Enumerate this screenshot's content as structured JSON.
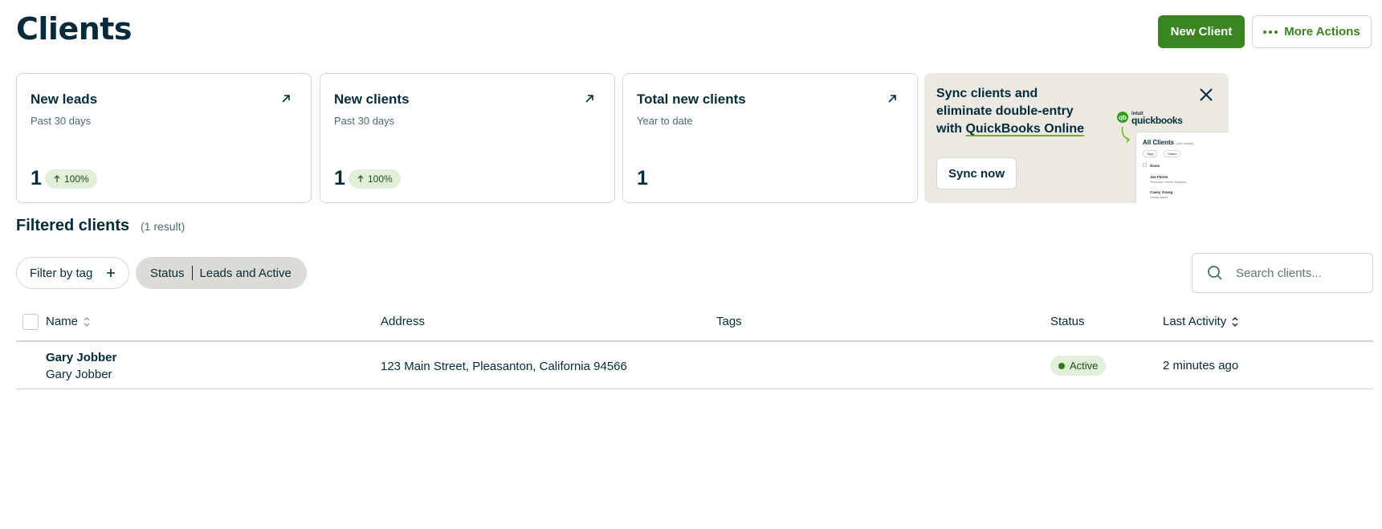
{
  "header": {
    "title": "Clients",
    "new_client_label": "New Client",
    "more_actions_label": "More Actions"
  },
  "cards": [
    {
      "title": "New leads",
      "subtitle": "Past 30 days",
      "value": "1",
      "trend": "100%"
    },
    {
      "title": "New clients",
      "subtitle": "Past 30 days",
      "value": "1",
      "trend": "100%"
    },
    {
      "title": "Total new clients",
      "subtitle": "Year to date",
      "value": "1",
      "trend": ""
    }
  ],
  "promo": {
    "text_before": "Sync clients and eliminate double-entry with ",
    "link": "QuickBooks Online",
    "button": "Sync now",
    "logo_small": "intuit",
    "logo_name": "quickbooks",
    "preview_title": "All Clients",
    "preview_count": "(320 results)",
    "preview_tag": "Tags",
    "preview_status": "Status",
    "preview_col": "Name",
    "preview_row1_name": "Joe Flores",
    "preview_row1_sub": "Flowmax: Home Dispatch",
    "preview_row2_name": "Casey Young",
    "preview_row2_sub": "Vanity Install"
  },
  "section": {
    "title": "Filtered clients",
    "result_count": "(1 result)"
  },
  "filters": {
    "tag_label": "Filter by tag",
    "status_key": "Status",
    "status_value": "Leads and Active"
  },
  "search": {
    "placeholder": "Search clients..."
  },
  "table": {
    "columns": [
      "Name",
      "Address",
      "Tags",
      "Status",
      "Last Activity"
    ],
    "rows": [
      {
        "name": "Gary Jobber",
        "sub": "Gary Jobber",
        "address": "123 Main Street, Pleasanton, California 94566",
        "tags": "",
        "status": "Active",
        "last_activity": "2 minutes ago"
      }
    ]
  },
  "colors": {
    "primary": "#3a8421",
    "text": "#032b3a",
    "badge_bg": "#e2f0d9",
    "promo_bg": "#ebe9e2"
  }
}
